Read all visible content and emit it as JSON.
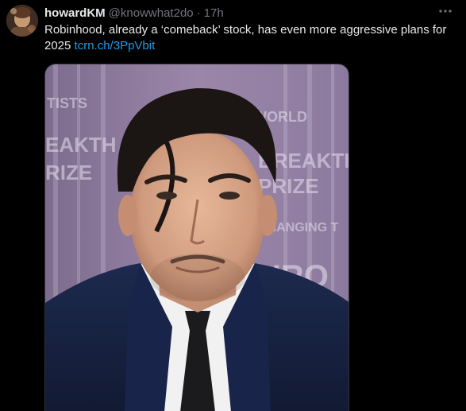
{
  "tweet": {
    "display_name": "howardKM",
    "handle": "@knowwhat2do",
    "separator": "·",
    "time": "17h",
    "more_icon": "more-horizontal-icon",
    "text": "Robinhood, already a ‘comeback’ stock, has even more aggressive plans for 2025",
    "link": "tcrn.ch/3PpVbit",
    "link_color": "#1d9bf0",
    "media": {
      "backdrop_text": [
        "TISTS",
        "WORLD",
        "EAKTH",
        "RIZE",
        "BREAKTH",
        "PRIZE",
        "CHANGING T",
        "HRO"
      ]
    }
  }
}
